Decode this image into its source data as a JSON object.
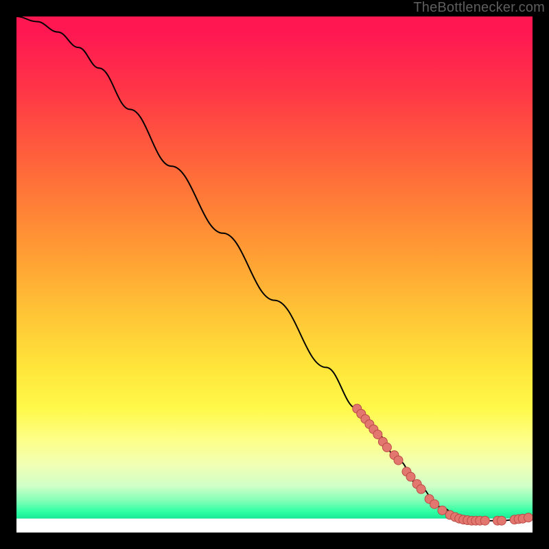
{
  "watermark": "TheBottlenecker.com",
  "chart_data": {
    "type": "line",
    "title": "",
    "xlabel": "",
    "ylabel": "",
    "xlim": [
      0,
      100
    ],
    "ylim": [
      0,
      100
    ],
    "curve": [
      {
        "x": 0,
        "y": 100
      },
      {
        "x": 4,
        "y": 99
      },
      {
        "x": 8,
        "y": 97
      },
      {
        "x": 12,
        "y": 94
      },
      {
        "x": 16,
        "y": 90
      },
      {
        "x": 22,
        "y": 82
      },
      {
        "x": 30,
        "y": 71
      },
      {
        "x": 40,
        "y": 58
      },
      {
        "x": 50,
        "y": 45
      },
      {
        "x": 60,
        "y": 32
      },
      {
        "x": 66,
        "y": 24
      },
      {
        "x": 70,
        "y": 19
      },
      {
        "x": 74,
        "y": 14
      },
      {
        "x": 78,
        "y": 9
      },
      {
        "x": 82,
        "y": 5
      },
      {
        "x": 86,
        "y": 3
      },
      {
        "x": 90,
        "y": 2.3
      },
      {
        "x": 94,
        "y": 2.3
      },
      {
        "x": 98,
        "y": 2.7
      },
      {
        "x": 100,
        "y": 3.0
      }
    ],
    "dots": [
      {
        "x": 66.0,
        "y": 24.0
      },
      {
        "x": 66.8,
        "y": 23.0
      },
      {
        "x": 67.6,
        "y": 22.0
      },
      {
        "x": 68.4,
        "y": 21.0
      },
      {
        "x": 69.2,
        "y": 20.0
      },
      {
        "x": 70.0,
        "y": 19.0
      },
      {
        "x": 71.0,
        "y": 17.6
      },
      {
        "x": 71.8,
        "y": 16.5
      },
      {
        "x": 73.2,
        "y": 15.0
      },
      {
        "x": 74.0,
        "y": 14.0
      },
      {
        "x": 75.6,
        "y": 11.8
      },
      {
        "x": 76.4,
        "y": 10.8
      },
      {
        "x": 77.6,
        "y": 9.4
      },
      {
        "x": 78.4,
        "y": 8.4
      },
      {
        "x": 80.0,
        "y": 6.5
      },
      {
        "x": 81.0,
        "y": 5.5
      },
      {
        "x": 82.5,
        "y": 4.3
      },
      {
        "x": 84.0,
        "y": 3.4
      },
      {
        "x": 85.0,
        "y": 3.0
      },
      {
        "x": 85.8,
        "y": 2.7
      },
      {
        "x": 86.6,
        "y": 2.5
      },
      {
        "x": 87.4,
        "y": 2.4
      },
      {
        "x": 88.2,
        "y": 2.3
      },
      {
        "x": 89.0,
        "y": 2.3
      },
      {
        "x": 89.8,
        "y": 2.3
      },
      {
        "x": 90.8,
        "y": 2.3
      },
      {
        "x": 93.2,
        "y": 2.3
      },
      {
        "x": 94.0,
        "y": 2.3
      },
      {
        "x": 96.5,
        "y": 2.5
      },
      {
        "x": 97.3,
        "y": 2.6
      },
      {
        "x": 98.1,
        "y": 2.7
      },
      {
        "x": 99.2,
        "y": 2.9
      }
    ],
    "colors": {
      "curve": "#000000",
      "dot_fill": "#e2776f",
      "dot_stroke": "#bb4a46"
    }
  }
}
